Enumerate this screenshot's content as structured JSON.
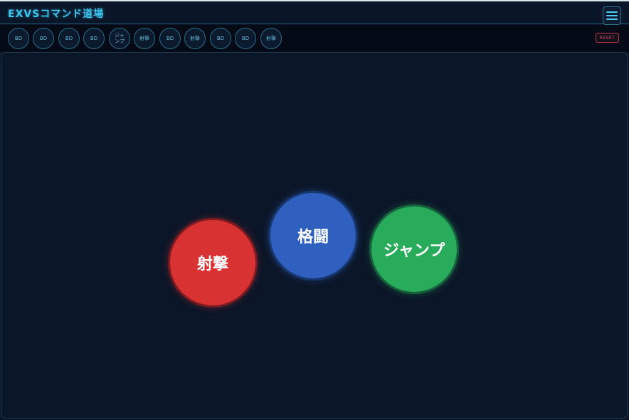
{
  "app": {
    "title": "EXVSコマンド道場"
  },
  "history": {
    "items": [
      "BD",
      "BD",
      "BD",
      "BD",
      "ジャ\nンプ",
      "射撃",
      "BD",
      "射撃",
      "BD",
      "BD",
      "射撃"
    ],
    "reset_label": "RESET"
  },
  "pad": {
    "shoot_label": "射撃",
    "melee_label": "格闘",
    "jump_label": "ジャンプ"
  },
  "colors": {
    "accent": "#3fc6ef",
    "shoot": "#d93232",
    "melee": "#2f5fbf",
    "jump": "#28ac5c",
    "reset": "#e04860"
  },
  "icons": {
    "menu": "hamburger-icon"
  }
}
